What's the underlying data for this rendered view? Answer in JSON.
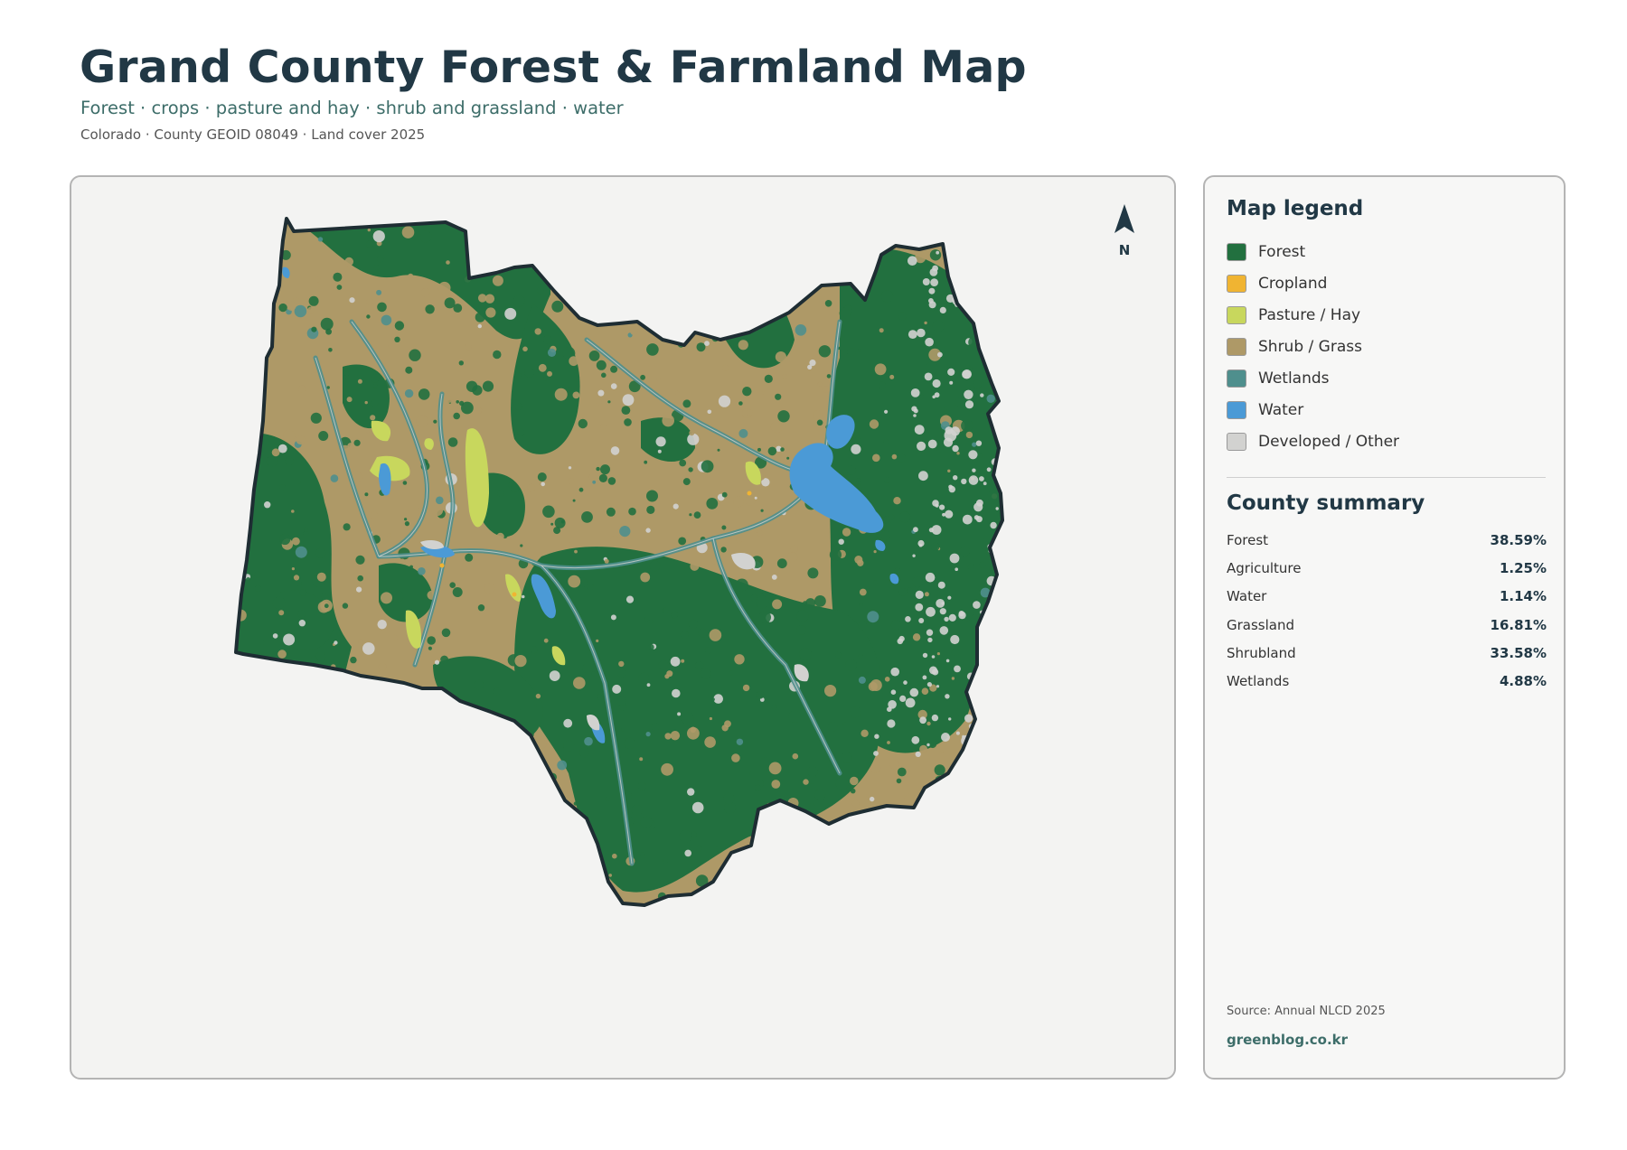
{
  "header": {
    "title": "Grand County Forest & Farmland Map",
    "subtitle": "Forest · crops · pasture and hay · shrub and grassland · water",
    "meta": "Colorado · County GEOID 08049 · Land cover 2025"
  },
  "map": {
    "north_label": "N",
    "colors": {
      "forest": "#22703f",
      "cropland": "#f0b432",
      "pasture": "#c8d75d",
      "shrub": "#ae9967",
      "wetlands": "#4f8f8d",
      "water": "#4b9ad6",
      "developed": "#d2d2d0",
      "boundary": "#1e2d33"
    }
  },
  "legend": {
    "heading": "Map legend",
    "items": [
      {
        "label": "Forest",
        "color": "#22703f"
      },
      {
        "label": "Cropland",
        "color": "#f0b432"
      },
      {
        "label": "Pasture / Hay",
        "color": "#c8d75d"
      },
      {
        "label": "Shrub / Grass",
        "color": "#ae9967"
      },
      {
        "label": "Wetlands",
        "color": "#4f8f8d"
      },
      {
        "label": "Water",
        "color": "#4b9ad6"
      },
      {
        "label": "Developed / Other",
        "color": "#d2d2d0"
      }
    ]
  },
  "summary": {
    "heading": "County summary",
    "rows": [
      {
        "label": "Forest",
        "value": "38.59%"
      },
      {
        "label": "Agriculture",
        "value": "1.25%"
      },
      {
        "label": "Water",
        "value": "1.14%"
      },
      {
        "label": "Grassland",
        "value": "16.81%"
      },
      {
        "label": "Shrubland",
        "value": "33.58%"
      },
      {
        "label": "Wetlands",
        "value": "4.88%"
      }
    ]
  },
  "footer": {
    "source": "Source: Annual NLCD 2025",
    "site": "greenblog.co.kr"
  }
}
